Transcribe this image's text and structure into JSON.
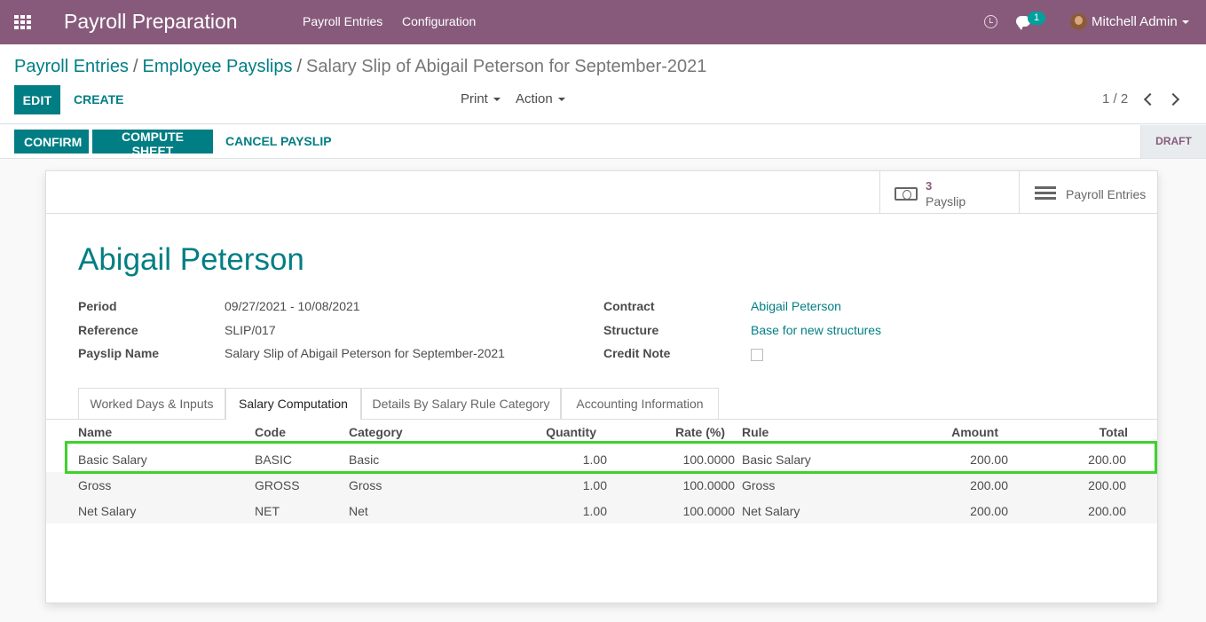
{
  "navbar": {
    "app_title": "Payroll Preparation",
    "menu": [
      "Payroll Entries",
      "Configuration"
    ],
    "chat_count": "1",
    "user_name": "Mitchell Admin"
  },
  "breadcrumb": {
    "items": [
      "Payroll Entries",
      "Employee Payslips"
    ],
    "current": "Salary Slip of Abigail Peterson for September-2021"
  },
  "actions": {
    "edit": "EDIT",
    "create": "CREATE",
    "print": "Print",
    "action": "Action",
    "pager": "1 / 2"
  },
  "statusbar": {
    "confirm": "CONFIRM",
    "compute_sheet": "COMPUTE SHEET",
    "cancel_payslip": "CANCEL PAYSLIP",
    "state": "DRAFT"
  },
  "smart_buttons": {
    "payslip_count": "3",
    "payslip_label": "Payslip",
    "entries_label": "Payroll Entries"
  },
  "form": {
    "employee": "Abigail Peterson",
    "period_label": "Period",
    "period": "09/27/2021 - 10/08/2021",
    "reference_label": "Reference",
    "reference": "SLIP/017",
    "payslip_name_label": "Payslip Name",
    "payslip_name": "Salary Slip of Abigail Peterson for September-2021",
    "contract_label": "Contract",
    "contract": "Abigail Peterson",
    "structure_label": "Structure",
    "structure": "Base for new structures",
    "credit_note_label": "Credit Note",
    "credit_note": false
  },
  "tabs": [
    {
      "label": "Worked Days & Inputs",
      "active": false
    },
    {
      "label": "Salary Computation",
      "active": true
    },
    {
      "label": "Details By Salary Rule Category",
      "active": false
    },
    {
      "label": "Accounting Information",
      "active": false
    }
  ],
  "table": {
    "headers": [
      "Name",
      "Code",
      "Category",
      "Quantity",
      "Rate (%)",
      "Rule",
      "Amount",
      "Total"
    ],
    "rows": [
      [
        "Basic Salary",
        "BASIC",
        "Basic",
        "1.00",
        "100.0000",
        "Basic Salary",
        "200.00",
        "200.00"
      ],
      [
        "Gross",
        "GROSS",
        "Gross",
        "1.00",
        "100.0000",
        "Gross",
        "200.00",
        "200.00"
      ],
      [
        "Net Salary",
        "NET",
        "Net",
        "1.00",
        "100.0000",
        "Net Salary",
        "200.00",
        "200.00"
      ]
    ]
  },
  "colors": {
    "navbar": "#875a7b",
    "primary": "#017e84",
    "highlight": "#3fd22c"
  }
}
